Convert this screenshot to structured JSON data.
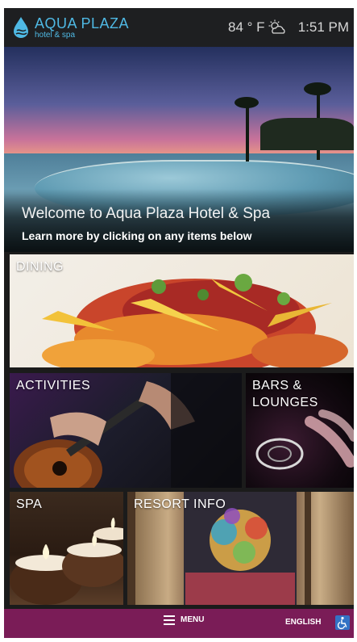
{
  "header": {
    "logo_title": "AQUA PLAZA",
    "logo_subtitle": "hotel & spa",
    "temperature": "84 ° F",
    "weather_icon": "partly-cloudy-icon",
    "time": "1:51 PM"
  },
  "hero": {
    "title": "Welcome to Aqua Plaza Hotel & Spa",
    "subtitle": "Learn more by clicking on any items below"
  },
  "tiles": {
    "dining": "DINING",
    "activities": "ACTIVITIES",
    "bars_line1": "BARS &",
    "bars_line2": "LOUNGES",
    "spa": "SPA",
    "resort_info": "RESORT INFO"
  },
  "bottom_bar": {
    "menu_label": "MENU",
    "language_label": "ENGLISH",
    "accessibility_icon": "wheelchair-icon"
  },
  "colors": {
    "brand_blue": "#4fb9e4",
    "bottom_bar": "#7a1c57",
    "accessibility_blue": "#3372c5"
  }
}
